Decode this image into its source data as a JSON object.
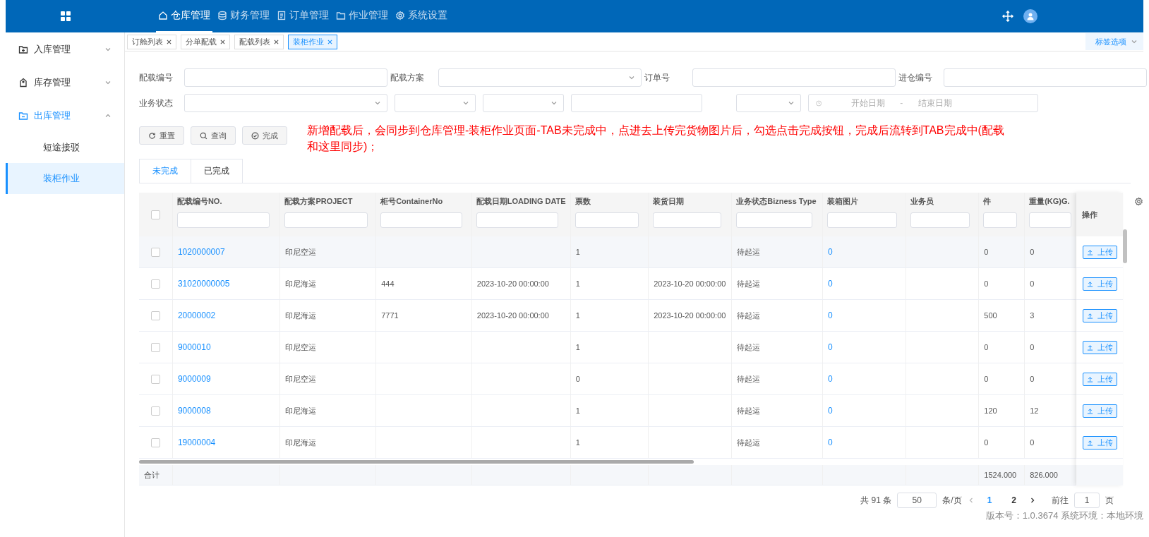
{
  "header": {
    "nav": [
      {
        "label": "仓库管理",
        "selected": true
      },
      {
        "label": "财务管理",
        "selected": false
      },
      {
        "label": "订单管理",
        "selected": false
      },
      {
        "label": "作业管理",
        "selected": false
      },
      {
        "label": "系统设置",
        "selected": false
      }
    ]
  },
  "sidebar": {
    "items": [
      {
        "label": "入库管理",
        "expanded": false
      },
      {
        "label": "库存管理",
        "expanded": false
      },
      {
        "label": "出库管理",
        "expanded": true,
        "children": [
          {
            "label": "短途接驳",
            "selected": false
          },
          {
            "label": "装柜作业",
            "selected": true
          }
        ]
      }
    ]
  },
  "tag_tabs": [
    {
      "label": "订舱列表",
      "selected": false
    },
    {
      "label": "分单配载",
      "selected": false
    },
    {
      "label": "配载列表",
      "selected": false
    },
    {
      "label": "装柜作业",
      "selected": true
    }
  ],
  "tag_options": "标签选项",
  "filters": [
    {
      "label": "配载编号",
      "kind": "text"
    },
    {
      "label": "配载方案",
      "kind": "select"
    },
    {
      "label": "订单号",
      "kind": "text"
    },
    {
      "label": "进仓编号",
      "kind": "text"
    },
    {
      "label": "业务状态",
      "kind": "select"
    },
    {
      "kind": "select"
    },
    {
      "kind": "select"
    },
    {
      "kind": "text"
    },
    {
      "kind": "select"
    },
    {
      "kind": "daterange",
      "start_placeholder": "开始日期",
      "separator": "-",
      "end_placeholder": "结束日期"
    }
  ],
  "buttons": [
    "重置",
    "查询",
    "完成"
  ],
  "note": "新增配载后，会同步到仓库管理-装柜作业页面-TAB未完成中，点进去上传完货物图片后，勾选点击完成按钮，完成后流转到TAB完成中(配载和这里同步)；",
  "status_tabs": [
    {
      "label": "未完成",
      "selected": true
    },
    {
      "label": "已完成",
      "selected": false
    }
  ],
  "table": {
    "select_all_checked": false,
    "columns": [
      "配载编号NO.",
      "配载方案PROJECT",
      "柜号ContainerNo",
      "配载日期LOADING DATE",
      "票数",
      "装货日期",
      "业务状态Bizness Type",
      "装箱图片",
      "业务员",
      "件",
      "重量(KG)G."
    ],
    "action_column": "操作",
    "rows": [
      {
        "checked": false,
        "cells": [
          "1020000007",
          "印尼空运",
          "",
          "",
          "1",
          "",
          "待起运",
          "0",
          "",
          "0",
          "0"
        ],
        "action": "上传"
      },
      {
        "checked": false,
        "cells": [
          "31020000005",
          "印尼海运",
          "444",
          "2023-10-20 00:00:00",
          "1",
          "2023-10-20 00:00:00",
          "待起运",
          "0",
          "",
          "0",
          "0"
        ],
        "action": "上传"
      },
      {
        "checked": false,
        "cells": [
          "20000002",
          "印尼海运",
          "7771",
          "2023-10-20 00:00:00",
          "1",
          "2023-10-20 00:00:00",
          "待起运",
          "0",
          "",
          "500",
          "3"
        ],
        "action": "上传"
      },
      {
        "checked": false,
        "cells": [
          "9000010",
          "印尼空运",
          "",
          "",
          "1",
          "",
          "待起运",
          "0",
          "",
          "0",
          "0"
        ],
        "action": "上传"
      },
      {
        "checked": false,
        "cells": [
          "9000009",
          "印尼空运",
          "",
          "",
          "0",
          "",
          "待起运",
          "0",
          "",
          "0",
          "0"
        ],
        "action": "上传"
      },
      {
        "checked": false,
        "cells": [
          "9000008",
          "印尼海运",
          "",
          "",
          "1",
          "",
          "待起运",
          "0",
          "",
          "120",
          "12"
        ],
        "action": "上传"
      },
      {
        "checked": false,
        "cells": [
          "19000004",
          "印尼海运",
          "",
          "",
          "1",
          "",
          "待起运",
          "0",
          "",
          "0",
          "0"
        ],
        "action": "上传"
      }
    ],
    "summary": {
      "label": "合计",
      "cells": [
        "",
        "",
        "",
        "",
        "",
        "",
        "",
        "",
        "",
        "1524.000",
        "826.000"
      ]
    }
  },
  "pagination": {
    "total": "共 91 条",
    "page_size": "50",
    "size_unit": "条/页",
    "pages": [
      {
        "label": "1",
        "selected": true
      },
      {
        "label": "2",
        "selected": false
      }
    ],
    "goto_label": "前往",
    "goto_value": "1",
    "page_unit": "页"
  },
  "version": "版本号：1.0.3674 系统环境：本地环境"
}
